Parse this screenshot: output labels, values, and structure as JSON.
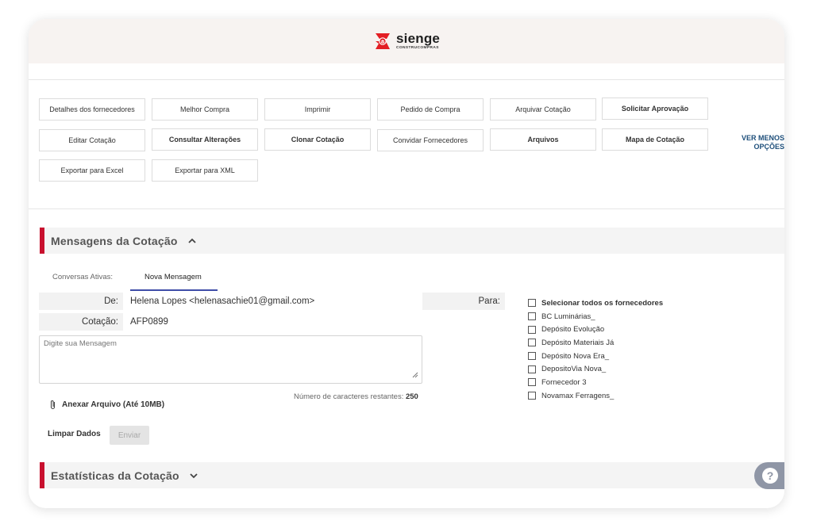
{
  "header": {
    "logo_name": "sienge",
    "logo_sub": "CONSTRUCOMPRAS",
    "brand_color": "#e31e24"
  },
  "toolbar": {
    "row1": [
      "Detalhes dos fornecedores",
      "Melhor Compra",
      "Imprimir",
      "Pedido de Compra",
      "Arquivar Cotação",
      "Solicitar Aprovação"
    ],
    "row2": [
      "Editar Cotação",
      "Consultar Alterações",
      "Clonar Cotação",
      "Convidar Fornecedores",
      "Arquivos",
      "Mapa de Cotação"
    ],
    "row3": [
      "Exportar para Excel",
      "Exportar para XML"
    ],
    "more_line1": "VER MENOS",
    "more_line2": "OPÇÕES"
  },
  "messages_section": {
    "title": "Mensagens da Cotação",
    "tabs": [
      {
        "label": "Conversas Ativas:",
        "active": false
      },
      {
        "label": "Nova Mensagem",
        "active": true
      }
    ],
    "from_label": "De:",
    "from_value": "Helena Lopes <helenasachie01@gmail.com>",
    "quote_label": "Cotação:",
    "quote_value": "AFP0899",
    "to_label": "Para:",
    "message_placeholder": "Digite sua Mensagem",
    "char_count_label": "Número de caracteres restantes:",
    "char_count_value": "250",
    "attach_label": "Anexar Arquivo (Até 10MB)",
    "clear_label": "Limpar Dados",
    "send_label": "Enviar",
    "suppliers": [
      {
        "label": "Selecionar todos os fornecedores",
        "checked": false
      },
      {
        "label": "BC Luminárias_",
        "checked": false
      },
      {
        "label": "Depósito Evolução",
        "checked": false
      },
      {
        "label": "Depósito Materiais Já",
        "checked": false
      },
      {
        "label": "Depósito Nova Era_",
        "checked": false
      },
      {
        "label": "DepositoVia Nova_",
        "checked": false
      },
      {
        "label": "Fornecedor 3",
        "checked": false
      },
      {
        "label": "Novamax Ferragens_",
        "checked": false
      }
    ]
  },
  "stats_section": {
    "title": "Estatísticas da Cotação"
  },
  "help": {
    "label": "?"
  },
  "colors": {
    "accent_red": "#c8102e",
    "tab_underline": "#3f4da8",
    "link_blue": "#1d4e7a"
  }
}
